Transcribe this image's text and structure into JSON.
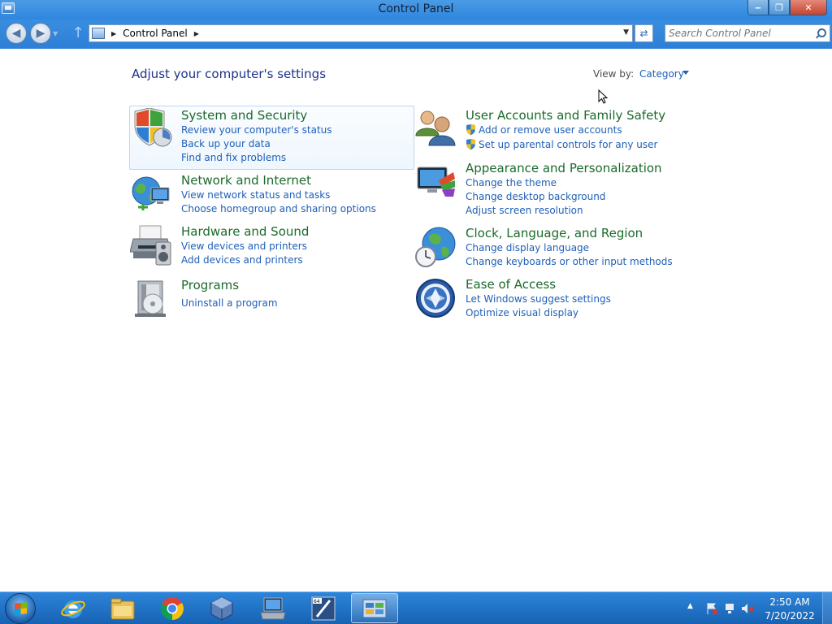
{
  "window": {
    "title": "Control Panel",
    "buttons": [
      "minimize",
      "maximize",
      "close"
    ]
  },
  "address": {
    "breadcrumb": "Control Panel",
    "search_placeholder": "Search Control Panel"
  },
  "content": {
    "heading": "Adjust your computer's settings",
    "view_by_label": "View by:",
    "view_by_value": "Category"
  },
  "categories": [
    {
      "title": "System and Security",
      "icon": "shield-icon",
      "links": [
        "Review your computer's status",
        "Back up your data",
        "Find and fix problems"
      ]
    },
    {
      "title": "Network and Internet",
      "icon": "network-globe-icon",
      "links": [
        "View network status and tasks",
        "Choose homegroup and sharing options"
      ]
    },
    {
      "title": "Hardware and Sound",
      "icon": "printer-speaker-icon",
      "links": [
        "View devices and printers",
        "Add devices and printers"
      ]
    },
    {
      "title": "Programs",
      "icon": "programs-icon",
      "links": [
        "Uninstall a program"
      ]
    },
    {
      "title": "User Accounts and Family Safety",
      "icon": "users-icon",
      "links": [
        "Add or remove user accounts",
        "Set up parental controls for any user"
      ]
    },
    {
      "title": "Appearance and Personalization",
      "icon": "monitor-paint-icon",
      "links": [
        "Change the theme",
        "Change desktop background",
        "Adjust screen resolution"
      ]
    },
    {
      "title": "Clock, Language, and Region",
      "icon": "globe-clock-icon",
      "links": [
        "Change display language",
        "Change keyboards or other input methods"
      ]
    },
    {
      "title": "Ease of Access",
      "icon": "ease-of-access-icon",
      "links": [
        "Let Windows suggest settings",
        "Optimize visual display"
      ]
    }
  ],
  "taskbar": {
    "apps": [
      "internet-explorer-icon",
      "file-explorer-icon",
      "chrome-icon",
      "virtualbox-icon",
      "network-pc-icon",
      "x64-app-icon",
      "control-panel-icon"
    ],
    "clock_time": "2:50 AM",
    "clock_date": "7/20/2022"
  },
  "colors": {
    "category_title": "#1a6b2a",
    "link": "#1e5fb8",
    "heading": "#1e3287",
    "chrome_blue": "#2f86de"
  }
}
